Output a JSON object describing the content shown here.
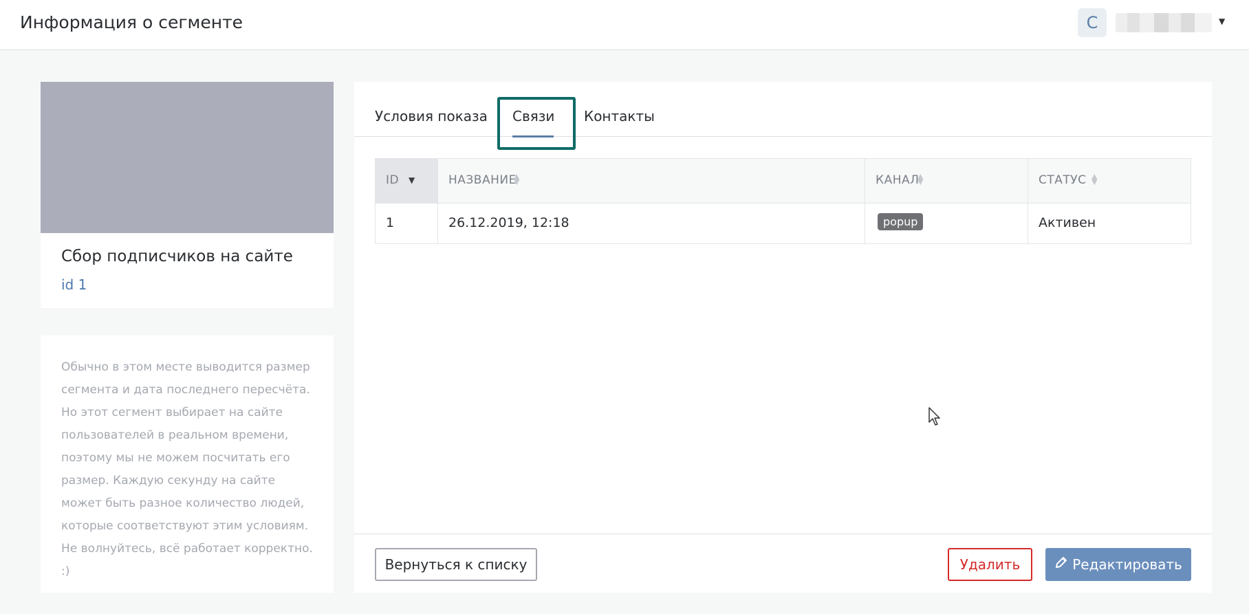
{
  "header": {
    "title": "Информация о сегменте",
    "avatar_letter": "С"
  },
  "segment": {
    "title": "Сбор подписчиков на сайте",
    "id_label": "id 1",
    "info_text": "Обычно в этом месте выводится размер сегмента и дата последнего пересчёта. Но этот сегмент выбирает на сайте пользователей в реальном времени, поэтому мы не можем посчитать его размер. Каждую секунду на сайте может быть разное количество людей, которые соответствуют этим условиям. Не волнуйтесь, всё работает корректно. :)"
  },
  "tabs": [
    {
      "label": "Условия показа"
    },
    {
      "label": "Связи",
      "active": true
    },
    {
      "label": "Контакты"
    }
  ],
  "table": {
    "columns": [
      "ID",
      "НАЗВАНИЕ",
      "КАНАЛ",
      "СТАТУС"
    ],
    "rows": [
      {
        "id": "1",
        "name": "26.12.2019, 12:18",
        "channel": "popup",
        "status": "Активен"
      }
    ]
  },
  "footer": {
    "back_label": "Вернуться к списку",
    "delete_label": "Удалить",
    "edit_label": "Редактировать"
  },
  "colors": {
    "accent": "#5a7fa6",
    "edit_button": "#6b8fbd",
    "delete": "#d42a2a",
    "highlight": "#0f6b66"
  }
}
